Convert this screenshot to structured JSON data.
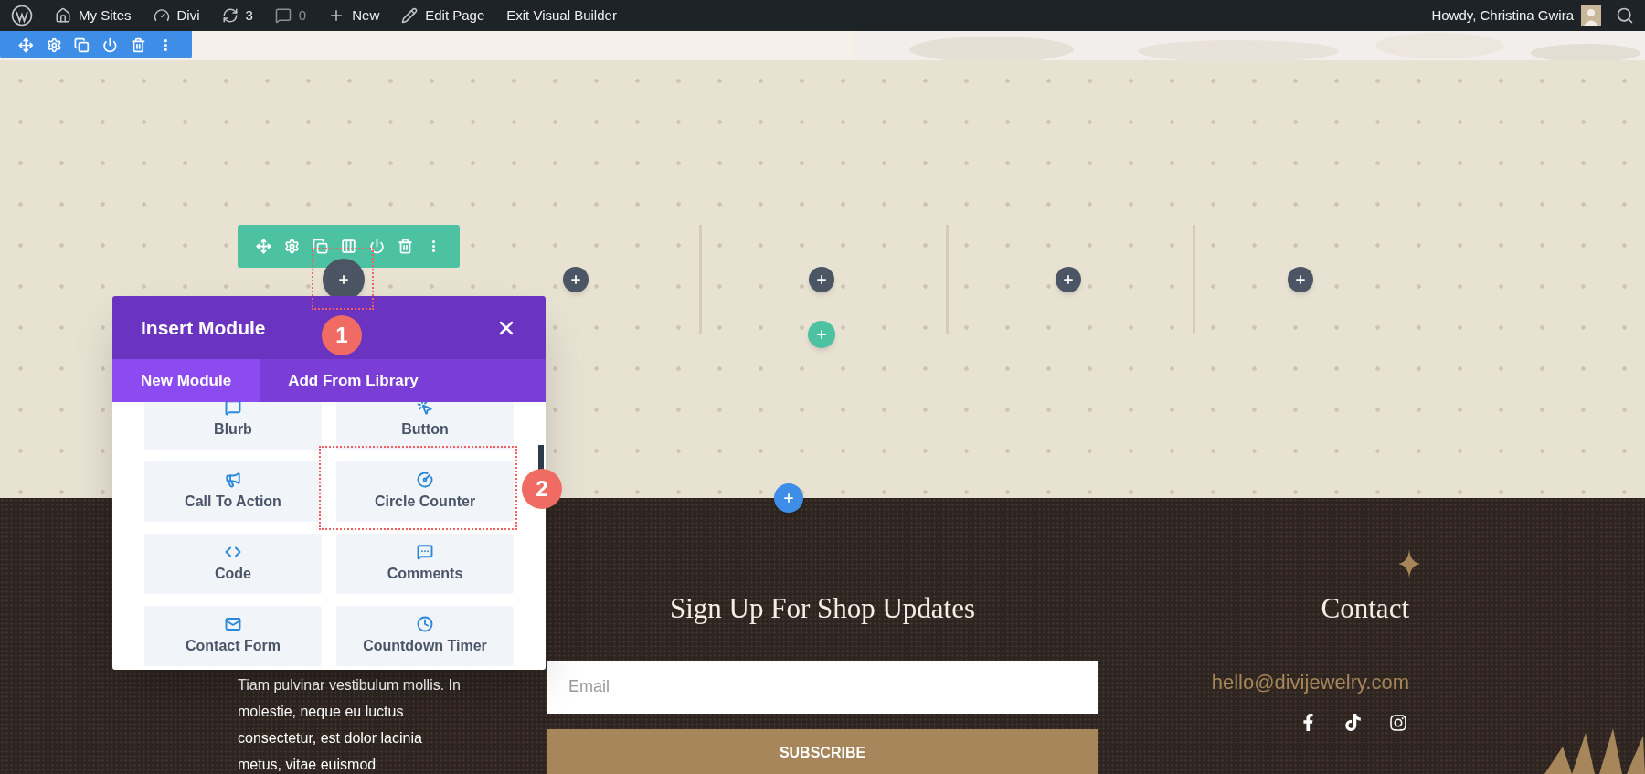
{
  "admin_bar": {
    "left": [
      {
        "kind": "logo"
      },
      {
        "kind": "sites",
        "label": "My Sites"
      },
      {
        "kind": "dashboard",
        "label": "Divi"
      },
      {
        "kind": "updates",
        "label": "3"
      },
      {
        "kind": "comments",
        "label": "0"
      },
      {
        "kind": "new",
        "label": "New"
      },
      {
        "kind": "edit",
        "label": "Edit Page"
      },
      {
        "kind": "plain",
        "label": "Exit Visual Builder"
      }
    ],
    "greeting": "Howdy, Christina Gwira"
  },
  "insert_module": {
    "title": "Insert Module",
    "tabs": [
      {
        "label": "New Module",
        "selected": true
      },
      {
        "label": "Add From Library",
        "selected": false
      }
    ],
    "modules": [
      {
        "label": "Blurb"
      },
      {
        "label": "Button"
      },
      {
        "label": "Call To Action"
      },
      {
        "label": "Circle Counter"
      },
      {
        "label": "Code"
      },
      {
        "label": "Comments"
      },
      {
        "label": "Contact Form"
      },
      {
        "label": "Countdown Timer"
      }
    ]
  },
  "callouts": [
    "1",
    "2"
  ],
  "footer": {
    "paragraph": "Tiam pulvinar vestibulum mollis. In molestie, neque eu luctus consectetur, est dolor lacinia metus, vitae euismod",
    "signup_title": "Sign Up For Shop Updates",
    "email_placeholder": "Email",
    "subscribe": "SUBSCRIBE",
    "contact_title": "Contact",
    "contact_email": "hello@divijewelry.com"
  }
}
